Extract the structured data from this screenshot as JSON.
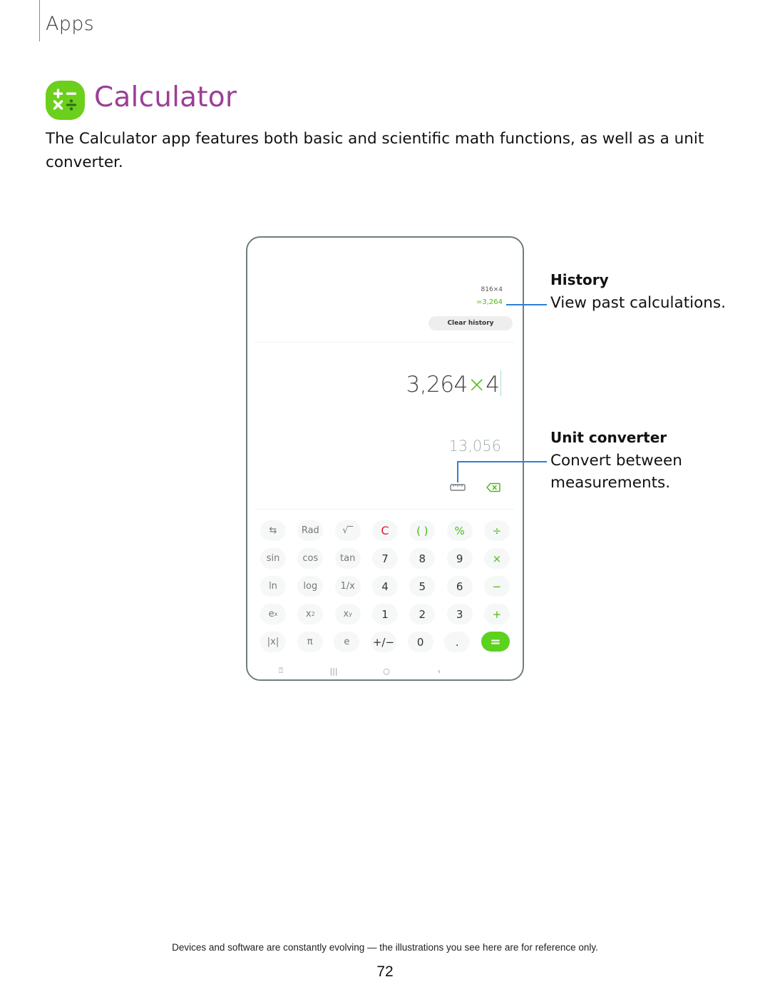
{
  "section": {
    "label": "Apps"
  },
  "page": {
    "title": "Calculator",
    "icon": "calculator-icon",
    "brand_color": "#6ccf1c",
    "title_color": "#9b3f97",
    "intro": "The Calculator app features both basic and scientific math functions, as well as a unit converter."
  },
  "device": {
    "history": {
      "expression": "816×4",
      "result": "=3,264",
      "clear_label": "Clear history"
    },
    "display": {
      "expression_number": "3,264",
      "expression_operator": "×",
      "expression_operand": "4",
      "preview_result": "13,056"
    },
    "icons": {
      "unit_converter": "ruler-icon",
      "backspace": "backspace-icon"
    },
    "keypad": [
      [
        {
          "label": "⇆",
          "kind": "fn",
          "name": "toggle-keypad-key"
        },
        {
          "label": "Rad",
          "kind": "fn",
          "name": "rad-key"
        },
        {
          "label": "√‾",
          "kind": "fn",
          "name": "sqrt-key"
        },
        {
          "label": "C",
          "kind": "clear",
          "name": "clear-key"
        },
        {
          "label": "( )",
          "kind": "green",
          "name": "parentheses-key"
        },
        {
          "label": "%",
          "kind": "green",
          "name": "percent-key"
        },
        {
          "label": "÷",
          "kind": "green",
          "name": "divide-key"
        }
      ],
      [
        {
          "label": "sin",
          "kind": "fn",
          "name": "sin-key"
        },
        {
          "label": "cos",
          "kind": "fn",
          "name": "cos-key"
        },
        {
          "label": "tan",
          "kind": "fn",
          "name": "tan-key"
        },
        {
          "label": "7",
          "kind": "num",
          "name": "digit-7-key"
        },
        {
          "label": "8",
          "kind": "num",
          "name": "digit-8-key"
        },
        {
          "label": "9",
          "kind": "num",
          "name": "digit-9-key"
        },
        {
          "label": "×",
          "kind": "green",
          "name": "multiply-key"
        }
      ],
      [
        {
          "label": "ln",
          "kind": "fn",
          "name": "ln-key"
        },
        {
          "label": "log",
          "kind": "fn",
          "name": "log-key"
        },
        {
          "label": "1/x",
          "kind": "fn",
          "name": "reciprocal-key"
        },
        {
          "label": "4",
          "kind": "num",
          "name": "digit-4-key"
        },
        {
          "label": "5",
          "kind": "num",
          "name": "digit-5-key"
        },
        {
          "label": "6",
          "kind": "num",
          "name": "digit-6-key"
        },
        {
          "label": "−",
          "kind": "green",
          "name": "subtract-key"
        }
      ],
      [
        {
          "label": "e",
          "sup": "x",
          "kind": "fn",
          "name": "exp-key"
        },
        {
          "label": "x",
          "sup": "2",
          "kind": "fn",
          "name": "square-key"
        },
        {
          "label": "x",
          "sup": "y",
          "kind": "fn",
          "name": "power-key"
        },
        {
          "label": "1",
          "kind": "num",
          "name": "digit-1-key"
        },
        {
          "label": "2",
          "kind": "num",
          "name": "digit-2-key"
        },
        {
          "label": "3",
          "kind": "num",
          "name": "digit-3-key"
        },
        {
          "label": "+",
          "kind": "green",
          "name": "add-key"
        }
      ],
      [
        {
          "label": "|x|",
          "kind": "fn",
          "name": "abs-key"
        },
        {
          "label": "π",
          "kind": "fn",
          "name": "pi-key"
        },
        {
          "label": "e",
          "kind": "fn",
          "name": "euler-key"
        },
        {
          "label": "+/−",
          "kind": "num",
          "name": "negate-key"
        },
        {
          "label": "0",
          "kind": "num",
          "name": "digit-0-key"
        },
        {
          "label": ".",
          "kind": "num",
          "name": "decimal-key"
        },
        {
          "label": "=",
          "kind": "equals",
          "name": "equals-key"
        }
      ]
    ],
    "navbar": [
      {
        "label": "⍰",
        "name": "screenshot-nav-icon"
      },
      {
        "label": "|||",
        "name": "recent-apps-nav-icon"
      },
      {
        "label": "○",
        "name": "home-nav-icon"
      },
      {
        "label": "‹",
        "name": "back-nav-icon"
      }
    ]
  },
  "callouts": {
    "history": {
      "title": "History",
      "description": "View past calculations."
    },
    "unit_converter": {
      "title": "Unit converter",
      "description": "Convert between measurements."
    },
    "line_color": "#2e7fd6"
  },
  "footer": {
    "note": "Devices and software are constantly evolving — the illustrations you see here are for reference only.",
    "page_number": "72"
  }
}
